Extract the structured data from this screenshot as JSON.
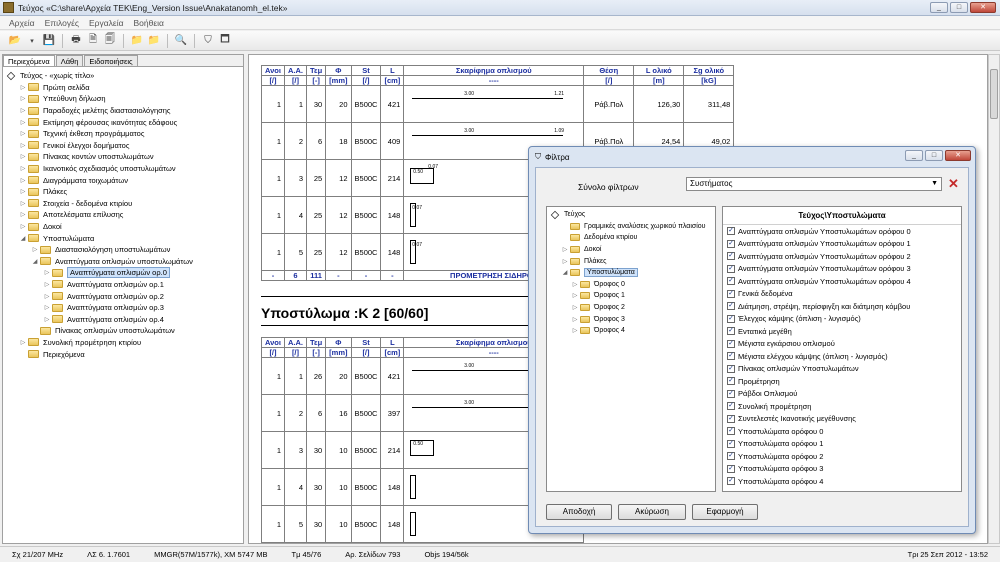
{
  "window": {
    "title": "Τεύχος «C:\\share\\Αρχεία ΤΕΚ\\Eng_Version Issue\\Anakatanomh_el.tek»"
  },
  "menu": [
    "Αρχεία",
    "Επιλογές",
    "Εργαλεία",
    "Βοήθεια"
  ],
  "tabs": [
    "Περιεχόμενα",
    "Λάθη",
    "Ειδοποιήσεις"
  ],
  "tree": [
    {
      "label": "Τεύχος - «χωρίς τίτλο»",
      "level": 0,
      "type": "root"
    },
    {
      "label": "Πρώτη σελίδα",
      "level": 1,
      "type": "folder",
      "expand": "+"
    },
    {
      "label": "Υπεύθυνη δήλωση",
      "level": 1,
      "type": "folder",
      "expand": "+"
    },
    {
      "label": "Παραδοχές μελέτης διαστασιολόγησης",
      "level": 1,
      "type": "folder",
      "expand": "+"
    },
    {
      "label": "Εκτίμηση φέρουσας ικανότητας εδάφους",
      "level": 1,
      "type": "folder",
      "expand": "+"
    },
    {
      "label": "Τεχνική έκθεση προγράμματος",
      "level": 1,
      "type": "folder",
      "expand": "+"
    },
    {
      "label": "Γενικοί έλεγχοι δομήματος",
      "level": 1,
      "type": "folder",
      "expand": "+"
    },
    {
      "label": "Πίνακας κοντών υποστυλωμάτων",
      "level": 1,
      "type": "folder",
      "expand": "+"
    },
    {
      "label": "Ικανοτικός σχεδιασμός υποστυλωμάτων",
      "level": 1,
      "type": "folder",
      "expand": "+"
    },
    {
      "label": "Διαγράμματα τοιχωμάτων",
      "level": 1,
      "type": "folder",
      "expand": "+"
    },
    {
      "label": "Πλάκες",
      "level": 1,
      "type": "folder",
      "expand": "+"
    },
    {
      "label": "Στοιχεία - δεδομένα κτιρίου",
      "level": 1,
      "type": "folder",
      "expand": "+"
    },
    {
      "label": "Αποτελέσματα επίλυσης",
      "level": 1,
      "type": "folder",
      "expand": "+"
    },
    {
      "label": "Δοκοί",
      "level": 1,
      "type": "folder",
      "expand": "+"
    },
    {
      "label": "Υποστυλώματα",
      "level": 1,
      "type": "folder",
      "expand": "-"
    },
    {
      "label": "Διαστασιολόγηση υποστυλωμάτων",
      "level": 2,
      "type": "folder",
      "expand": "+"
    },
    {
      "label": "Αναπτύγματα οπλισμών υποστυλωμάτων",
      "level": 2,
      "type": "folder",
      "expand": "-"
    },
    {
      "label": "Αναπτύγματα οπλισμών ορ.0",
      "level": 3,
      "type": "folder",
      "expand": "+",
      "selected": true
    },
    {
      "label": "Αναπτύγματα οπλισμών ορ.1",
      "level": 3,
      "type": "folder",
      "expand": "+"
    },
    {
      "label": "Αναπτύγματα οπλισμών ορ.2",
      "level": 3,
      "type": "folder",
      "expand": "+"
    },
    {
      "label": "Αναπτύγματα οπλισμών ορ.3",
      "level": 3,
      "type": "folder",
      "expand": "+"
    },
    {
      "label": "Αναπτύγματα οπλισμών ορ.4",
      "level": 3,
      "type": "folder",
      "expand": "+"
    },
    {
      "label": "Πίνακας οπλισμών υποστυλωμάτων",
      "level": 2,
      "type": "folder",
      "expand": ""
    },
    {
      "label": "Συνολική προμέτρηση κτιρίου",
      "level": 1,
      "type": "folder",
      "expand": "+"
    },
    {
      "label": "Περιεχόμενα",
      "level": 1,
      "type": "folder",
      "expand": ""
    }
  ],
  "table_headers": [
    [
      "Ανοι",
      "Α.Α.",
      "Τεμ",
      "Φ",
      "St",
      "L",
      "Σκαρίφημα οπλισμού",
      "Θέση",
      "L ολικό",
      "Σg ολικό"
    ],
    [
      "[/]",
      "[/]",
      "[-]",
      "[mm]",
      "[/]",
      "[cm]",
      "----",
      "[/]",
      "[m]",
      "[kG]"
    ]
  ],
  "table1": {
    "rows": [
      {
        "c": [
          "1",
          "1",
          "30",
          "20",
          "B500C",
          "421"
        ],
        "pos": "Ράβ.Πολ",
        "lt": "126,30",
        "gt": "311,48",
        "sk": "line",
        "t1": "3.00",
        "t2": "1.21"
      },
      {
        "c": [
          "1",
          "2",
          "6",
          "18",
          "B500C",
          "409"
        ],
        "pos": "Ράβ.Πολ",
        "lt": "24,54",
        "gt": "49,02",
        "sk": "line",
        "t1": "3.00",
        "t2": "1.09"
      },
      {
        "c": [
          "1",
          "3",
          "25",
          "12",
          "B500C",
          "214"
        ],
        "pos": "",
        "lt": "",
        "gt": "",
        "sk": "box",
        "t1": "0.50",
        "t2": "0.07"
      },
      {
        "c": [
          "1",
          "4",
          "25",
          "12",
          "B500C",
          "148"
        ],
        "pos": "",
        "lt": "",
        "gt": "",
        "sk": "bar",
        "t1": "0.07",
        "t2": ""
      },
      {
        "c": [
          "1",
          "5",
          "25",
          "12",
          "B500C",
          "148"
        ],
        "pos": "",
        "lt": "",
        "gt": "",
        "sk": "bar",
        "t1": "0.07",
        "t2": ""
      }
    ],
    "sum": {
      "c1": "-",
      "c2": "6",
      "c3": "111",
      "c4": "-",
      "c5": "-",
      "c6": "-",
      "label": "ΠΡΟΜΕΤΡΗΣΗ ΣΙΔΗΡΟΥ"
    }
  },
  "section2_title": "Υποστύλωμα :K 2  [60/60]",
  "table2": {
    "rows": [
      {
        "c": [
          "1",
          "1",
          "26",
          "20",
          "B500C",
          "421"
        ],
        "sk": "line",
        "t1": "3.00"
      },
      {
        "c": [
          "1",
          "2",
          "6",
          "16",
          "B500C",
          "397"
        ],
        "sk": "line",
        "t1": "3.00"
      },
      {
        "c": [
          "1",
          "3",
          "30",
          "10",
          "B500C",
          "214"
        ],
        "sk": "box",
        "t1": "0.50"
      },
      {
        "c": [
          "1",
          "4",
          "30",
          "10",
          "B500C",
          "148"
        ],
        "sk": "bar",
        "t1": ""
      },
      {
        "c": [
          "1",
          "5",
          "30",
          "10",
          "B500C",
          "148"
        ],
        "sk": "bar",
        "t1": ""
      }
    ]
  },
  "status": [
    "Σχ 21/207 MHz",
    "ΛΣ 6. 1.7601",
    "MMGR(57M/1577k), XM 5747 MB",
    "Tμ 45/76",
    "Αρ. Σελίδων 793",
    "Objs 194/56k",
    "Τρι 25 Σεπ 2012 - 13:52"
  ],
  "dialog": {
    "title": "Φίλτρα",
    "filter_set_label": "Σύνολο φίλτρων",
    "filter_set_value": "Συστήματος",
    "tree": [
      {
        "label": "Τεύχος",
        "level": 0,
        "type": "root"
      },
      {
        "label": "Γραμμικές αναλύσεις χωρικού πλαισίου",
        "level": 1,
        "type": "folder",
        "expand": ""
      },
      {
        "label": "Δεδομένα κτιρίου",
        "level": 1,
        "type": "folder",
        "expand": ""
      },
      {
        "label": "Δοκοί",
        "level": 1,
        "type": "folder",
        "expand": "+"
      },
      {
        "label": "Πλάκες",
        "level": 1,
        "type": "folder",
        "expand": "+"
      },
      {
        "label": "Υποστυλώματα",
        "level": 1,
        "type": "folder",
        "expand": "-",
        "selected": true
      },
      {
        "label": "Όροφος 0",
        "level": 2,
        "type": "folder",
        "expand": "+"
      },
      {
        "label": "Όροφος 1",
        "level": 2,
        "type": "folder",
        "expand": "+"
      },
      {
        "label": "Όροφος 2",
        "level": 2,
        "type": "folder",
        "expand": "+"
      },
      {
        "label": "Όροφος 3",
        "level": 2,
        "type": "folder",
        "expand": "+"
      },
      {
        "label": "Όροφος 4",
        "level": 2,
        "type": "folder",
        "expand": "+"
      }
    ],
    "list_header": "Τεύχος\\Υποστυλώματα",
    "list": [
      "Αναπτύγματα οπλισμών Υποστυλωμάτων ορόφου 0",
      "Αναπτύγματα οπλισμών Υποστυλωμάτων ορόφου 1",
      "Αναπτύγματα οπλισμών Υποστυλωμάτων ορόφου 2",
      "Αναπτύγματα οπλισμών Υποστυλωμάτων ορόφου 3",
      "Αναπτύγματα οπλισμών Υποστυλωμάτων ορόφου 4",
      "Γενικά δεδομένα",
      "Διάτμηση, στρέψη, περίσφιγξη και διάτμηση κόμβου",
      "Έλεγχος κάμψης (όπλιση - λυγισμός)",
      "Εντατικά μεγέθη",
      "Μέγιστα εγκάρσιου οπλισμού",
      "Μέγιστα ελέγχου κάμψης (όπλιση - λυγισμός)",
      "Πίνακας οπλισμών Υποστυλωμάτων",
      "Προμέτρηση",
      "Ράβδοι Οπλισμού",
      "Συνολική προμέτρηση",
      "Συντελεστές Ικανοτικής μεγέθυνσης",
      "Υποστυλώματα ορόφου 0",
      "Υποστυλώματα ορόφου 1",
      "Υποστυλώματα ορόφου 2",
      "Υποστυλώματα ορόφου 3",
      "Υποστυλώματα ορόφου 4"
    ],
    "buttons": {
      "ok": "Αποδοχή",
      "cancel": "Ακύρωση",
      "apply": "Εφαρμογή"
    }
  }
}
